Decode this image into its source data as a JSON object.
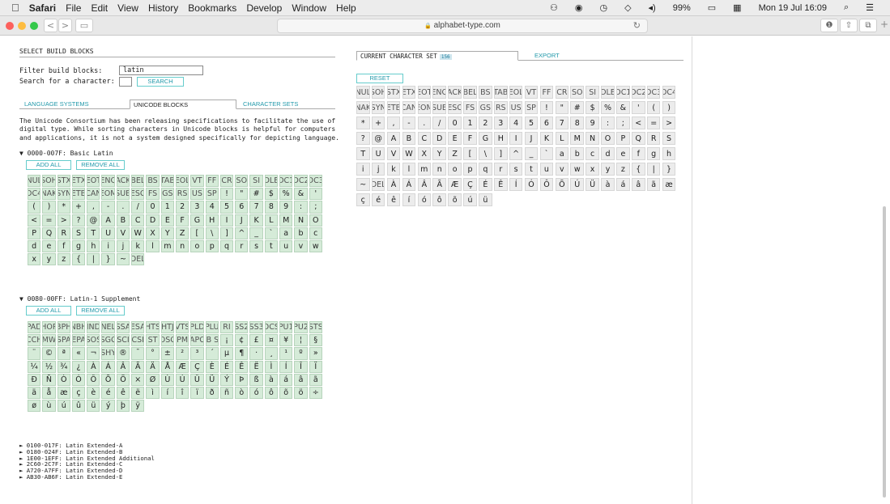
{
  "menubar": {
    "apple": "",
    "app": "Safari",
    "items": [
      "File",
      "Edit",
      "View",
      "History",
      "Bookmarks",
      "Develop",
      "Window",
      "Help"
    ],
    "battery": "99%",
    "datetime": "Mon 19 Jul 16:09"
  },
  "browser": {
    "url": "alphabet-type.com",
    "lock": "🔒",
    "reload": "↻",
    "back": "<",
    "forward": ">",
    "sidebar": "▭",
    "info": "❶",
    "share": "⇧",
    "tabs": "⧉",
    "plus": "+"
  },
  "left": {
    "title": "SELECT BUILD BLOCKS",
    "filter_label": "Filter build blocks:",
    "filter_value": "latin",
    "search_label": "Search for a character:",
    "search_button": "SEARCH",
    "tabs": [
      "LANGUAGE SYSTEMS",
      "UNICODE BLOCKS",
      "CHARACTER SETS"
    ],
    "description": "The Unicode Consortium has been releasing specifications to facilitate the use of digital type. While sorting characters in Unicode blocks is helpful for computers and applications, it is not a system designed specifically for depicting language.",
    "block1": {
      "title": "▼ 0000-007F: Basic Latin",
      "add": "ADD ALL",
      "remove": "REMOVE ALL",
      "chars": [
        "NUL",
        "SOH",
        "STX",
        "ETX",
        "EOT",
        "ENQ",
        "ACK",
        "BEL",
        "BS",
        "TAB",
        "EOL",
        "VT",
        "FF",
        "CR",
        "SO",
        "SI",
        "DLE",
        "DC1",
        "DC2",
        "DC3",
        "DC4",
        "NAK",
        "SYN",
        "ETB",
        "CAN",
        "EOM",
        "SUB",
        "ESC",
        "FS",
        "GS",
        "RS",
        "US",
        "SP",
        "!",
        "\"",
        "#",
        "$",
        "%",
        "&",
        "'",
        "(",
        ")",
        "*",
        "+",
        ",",
        "-",
        ".",
        "/",
        "0",
        "1",
        "2",
        "3",
        "4",
        "5",
        "6",
        "7",
        "8",
        "9",
        ":",
        ";",
        "<",
        "=",
        ">",
        "?",
        "@",
        "A",
        "B",
        "C",
        "D",
        "E",
        "F",
        "G",
        "H",
        "I",
        "J",
        "K",
        "L",
        "M",
        "N",
        "O",
        "P",
        "Q",
        "R",
        "S",
        "T",
        "U",
        "V",
        "W",
        "X",
        "Y",
        "Z",
        "[",
        "\\",
        "]",
        "^",
        "_",
        "`",
        "a",
        "b",
        "c",
        "d",
        "e",
        "f",
        "g",
        "h",
        "i",
        "j",
        "k",
        "l",
        "m",
        "n",
        "o",
        "p",
        "q",
        "r",
        "s",
        "t",
        "u",
        "v",
        "w",
        "x",
        "y",
        "z",
        "{",
        "|",
        "}",
        "~",
        "DEL"
      ]
    },
    "block2": {
      "title": "▼ 0080-00FF: Latin-1 Supplement",
      "add": "ADD ALL",
      "remove": "REMOVE ALL",
      "chars": [
        "PAD",
        "HOP",
        "BPH",
        "NBH",
        "IND",
        "NEL",
        "SSA",
        "ESA",
        "HTS",
        "HTJ",
        "VTS",
        "PLD",
        "PLU",
        "RI",
        "SS2",
        "SS3",
        "DCS",
        "PU1",
        "PU2",
        "STS",
        "CCH",
        "MW",
        "SPA",
        "EPA",
        "SOS",
        "SGC",
        "SCI",
        "CSI",
        "ST",
        "OSC",
        "PM",
        "APC",
        "NB SP",
        "¡",
        "¢",
        "£",
        "¤",
        "¥",
        "¦",
        "§",
        "¨",
        "©",
        "ª",
        "«",
        "¬",
        "SHY",
        "®",
        "¯",
        "°",
        "±",
        "²",
        "³",
        "´",
        "µ",
        "¶",
        "·",
        "¸",
        "¹",
        "º",
        "»",
        "¼",
        "½",
        "¾",
        "¿",
        "À",
        "Á",
        "Â",
        "Ã",
        "Ä",
        "Å",
        "Æ",
        "Ç",
        "È",
        "É",
        "Ê",
        "Ë",
        "Ì",
        "Í",
        "Î",
        "Ï",
        "Ð",
        "Ñ",
        "Ò",
        "Ó",
        "Ô",
        "Õ",
        "Ö",
        "×",
        "Ø",
        "Ù",
        "Ú",
        "Û",
        "Ü",
        "Ý",
        "Þ",
        "ß",
        "à",
        "á",
        "â",
        "ã",
        "ä",
        "å",
        "æ",
        "ç",
        "è",
        "é",
        "ê",
        "ë",
        "ì",
        "í",
        "î",
        "ï",
        "ð",
        "ñ",
        "ò",
        "ó",
        "ô",
        "õ",
        "ö",
        "÷",
        "ø",
        "ù",
        "ú",
        "û",
        "ü",
        "ý",
        "þ",
        "ÿ"
      ]
    },
    "collapsed": [
      "► 0100-017F: Latin Extended-A",
      "► 0180-024F: Latin Extended-B",
      "► 1E00-1EFF: Latin Extended Additional",
      "► 2C60-2C7F: Latin Extended-C",
      "► A720-A7FF: Latin Extended-D",
      "► AB30-AB6F: Latin Extended-E"
    ]
  },
  "right": {
    "tab_current": "CURRENT CHARACTER SET",
    "count": "156",
    "tab_export": "EXPORT",
    "reset": "RESET",
    "chars": [
      "NUL",
      "SOH",
      "STX",
      "ETX",
      "EOT",
      "ENQ",
      "ACK",
      "BEL",
      "BS",
      "TAB",
      "EOL",
      "VT",
      "FF",
      "CR",
      "SO",
      "SI",
      "DLE",
      "DC1",
      "DC2",
      "DC3",
      "DC4",
      "NAK",
      "SYN",
      "ETB",
      "CAN",
      "EOM",
      "SUB",
      "ESC",
      "FS",
      "GS",
      "RS",
      "US",
      "SP",
      "!",
      "\"",
      "#",
      "$",
      "%",
      "&",
      "'",
      "(",
      ")",
      "*",
      "+",
      ",",
      "-",
      ".",
      "/",
      "0",
      "1",
      "2",
      "3",
      "4",
      "5",
      "6",
      "7",
      "8",
      "9",
      ":",
      ";",
      "<",
      "=",
      ">",
      "?",
      "@",
      "A",
      "B",
      "C",
      "D",
      "E",
      "F",
      "G",
      "H",
      "I",
      "J",
      "K",
      "L",
      "M",
      "N",
      "O",
      "P",
      "Q",
      "R",
      "S",
      "T",
      "U",
      "V",
      "W",
      "X",
      "Y",
      "Z",
      "[",
      "\\",
      "]",
      "^",
      "_",
      "`",
      "a",
      "b",
      "c",
      "d",
      "e",
      "f",
      "g",
      "h",
      "i",
      "j",
      "k",
      "l",
      "m",
      "n",
      "o",
      "p",
      "q",
      "r",
      "s",
      "t",
      "u",
      "v",
      "w",
      "x",
      "y",
      "z",
      "{",
      "|",
      "}",
      "~",
      "DEL",
      "À",
      "Á",
      "Â",
      "Ã",
      "Æ",
      "Ç",
      "É",
      "Ê",
      "Í",
      "Ó",
      "Ô",
      "Õ",
      "Ú",
      "Ü",
      "à",
      "á",
      "â",
      "ã",
      "æ",
      "ç",
      "é",
      "ê",
      "í",
      "ó",
      "ô",
      "õ",
      "ú",
      "ü"
    ]
  }
}
